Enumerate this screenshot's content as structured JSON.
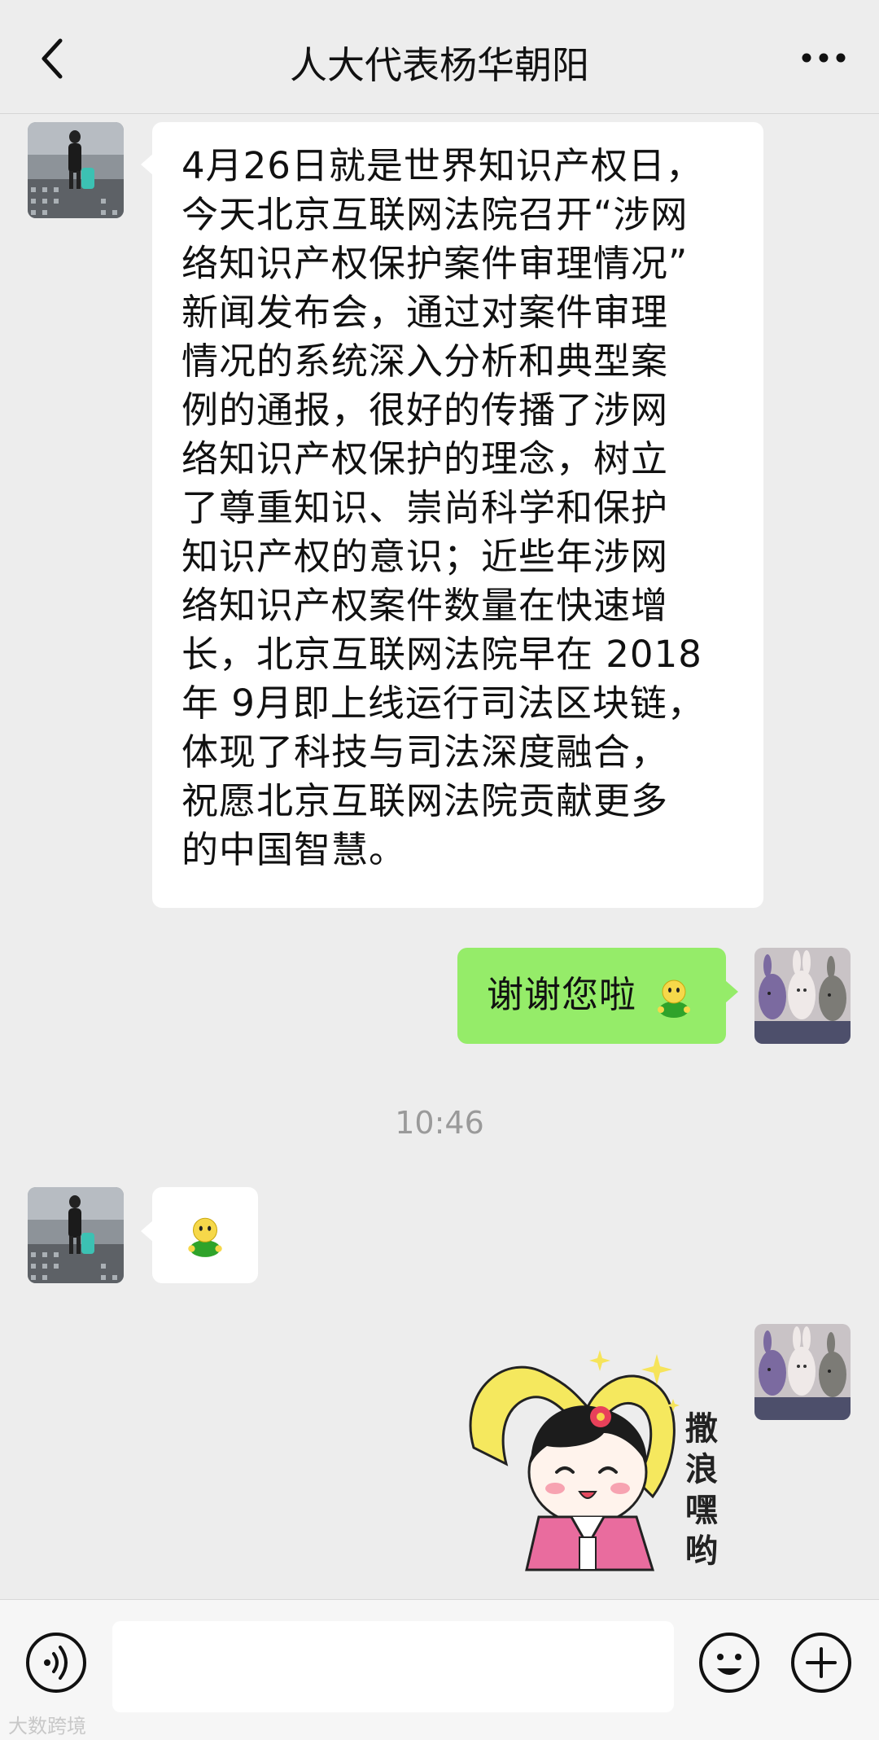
{
  "header": {
    "title": "人大代表杨华朝阳",
    "back_icon": "chevron-left-icon",
    "more_icon": "more-dots-icon"
  },
  "messages": [
    {
      "side": "left",
      "type": "text",
      "text": "4月26日就是世界知识产权日，\n今天北京互联网法院召开“涉网\n络知识产权保护案件审理情况”\n新闻发布会，通过对案件审理\n情况的系统深入分析和典型案\n例的通报，很好的传播了涉网\n络知识产权保护的理念，树立\n了尊重知识、崇尚科学和保护\n知识产权的意识；近些年涉网\n络知识产权案件数量在快速增\n长，北京互联网法院早在 2018\n年 9月即上线运行司法区块链，\n体现了科技与司法深度融合，\n祝愿北京互联网法院贡献更多\n的中国智慧。"
    },
    {
      "side": "right",
      "type": "text",
      "text": "谢谢您啦"
    },
    {
      "side": "left",
      "type": "emoji",
      "emoji": "smiley-emoji"
    },
    {
      "side": "right",
      "type": "sticker",
      "sticker_text": "撒浪嘿哟"
    }
  ],
  "timestamp": "10:46",
  "input_bar": {
    "voice_icon": "voice-icon",
    "emoji_icon": "emoji-icon",
    "plus_icon": "plus-icon",
    "value": ""
  },
  "watermark": "大数跨境",
  "colors": {
    "background": "#ededed",
    "self_bubble": "#95ec69",
    "other_bubble": "#ffffff",
    "timestamp": "#9a9a9a"
  }
}
